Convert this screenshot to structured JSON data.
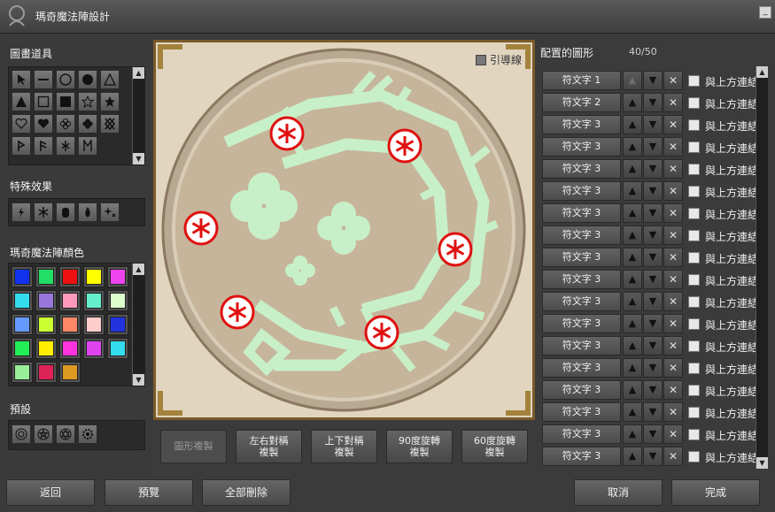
{
  "window": {
    "title": "瑪奇魔法陣設計",
    "minimize": "_"
  },
  "left": {
    "tools_label": "圖畫道具",
    "effects_label": "特殊效果",
    "colors_label": "瑪奇魔法陣顏色",
    "presets_label": "預設",
    "colors": [
      "#1133ee",
      "#22dd66",
      "#ee1111",
      "#ffff00",
      "#ee44ee",
      "#33ddee",
      "#9977dd",
      "#ff99bb",
      "#66eecc",
      "#ddffcc",
      "#6699ff",
      "#ccff33",
      "#ff8866",
      "#ffcccc",
      "#2233dd",
      "#22ee55",
      "#ffee00",
      "#ff33dd",
      "#dd44ee",
      "#33ddee",
      "#99ee99",
      "#dd2255",
      "#dd9922"
    ]
  },
  "canvas": {
    "guide_label": "引導線"
  },
  "mirror_buttons": [
    {
      "label": "圖形複製",
      "disabled": true
    },
    {
      "label1": "左右對稱",
      "label2": "複製"
    },
    {
      "label1": "上下對稱",
      "label2": "複製"
    },
    {
      "label1": "90度旋轉",
      "label2": "複製"
    },
    {
      "label1": "60度旋轉",
      "label2": "複製"
    }
  ],
  "right": {
    "title": "配置的圖形",
    "count": "40/50",
    "link_label": "與上方連結",
    "rows": [
      "符文字 1",
      "符文字 2",
      "符文字 3",
      "符文字 3",
      "符文字 3",
      "符文字 3",
      "符文字 3",
      "符文字 3",
      "符文字 3",
      "符文字 3",
      "符文字 3",
      "符文字 3",
      "符文字 3",
      "符文字 3",
      "符文字 3",
      "符文字 3",
      "符文字 3",
      "符文字 3"
    ]
  },
  "bottom": {
    "back": "返回",
    "preview": "預覽",
    "delete_all": "全部刪除",
    "cancel": "取消",
    "done": "完成"
  }
}
